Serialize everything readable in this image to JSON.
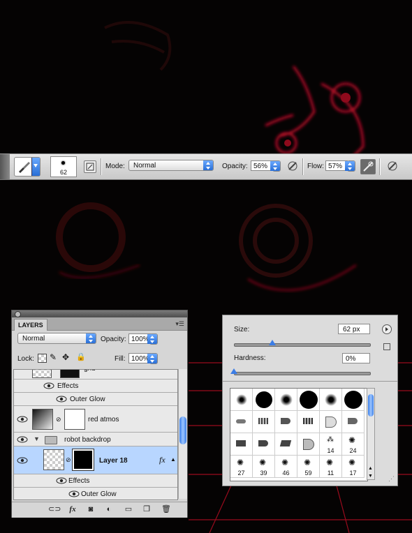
{
  "options_bar": {
    "brush_size": "62",
    "mode_label": "Mode:",
    "mode_value": "Normal",
    "opacity_label": "Opacity:",
    "opacity_value": "56%",
    "flow_label": "Flow:",
    "flow_value": "57%"
  },
  "layers_panel": {
    "tab": "LAYERS",
    "blend_mode": "Normal",
    "opacity_label": "Opacity:",
    "opacity_value": "100%",
    "lock_label": "Lock:",
    "fill_label": "Fill:",
    "fill_value": "100%",
    "rows": [
      {
        "label": "grid",
        "type": "layer"
      },
      {
        "label": "Effects",
        "type": "effects"
      },
      {
        "label": "Outer Glow",
        "type": "effect"
      },
      {
        "label": "red atmos",
        "type": "layer"
      },
      {
        "label": "robot backdrop",
        "type": "group"
      },
      {
        "label": "Layer 18",
        "type": "layer",
        "selected": true
      },
      {
        "label": "Effects",
        "type": "effects"
      },
      {
        "label": "Outer Glow",
        "type": "effect"
      }
    ],
    "fx_symbol": "fx"
  },
  "brush_panel": {
    "size_label": "Size:",
    "size_value": "62 px",
    "size_slider": 0.28,
    "hardness_label": "Hardness:",
    "hardness_value": "0%",
    "hardness_slider": 0.0,
    "brush_numbers": [
      "14",
      "24",
      "27",
      "39",
      "46",
      "59",
      "11",
      "17"
    ]
  },
  "colors": {
    "accent_blue": "#2a6fd6",
    "selection": "#b8d6ff",
    "glow_red": "#d4102a"
  }
}
